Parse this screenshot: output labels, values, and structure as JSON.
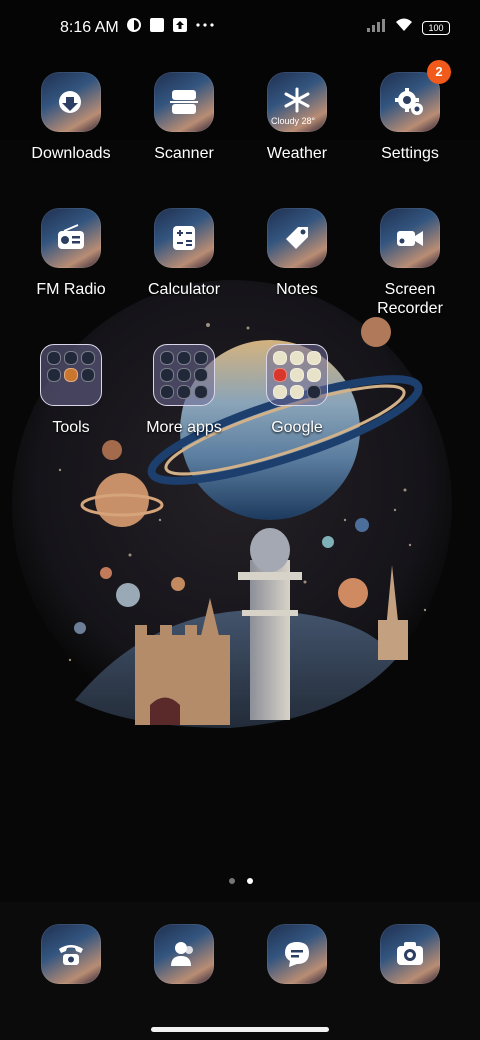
{
  "status_bar": {
    "time": "8:16 AM",
    "notification_icons": [
      "app-notification-icon",
      "white-square-icon",
      "upload-arrow-icon",
      "more-dots-icon"
    ],
    "battery_level": "100"
  },
  "home": {
    "apps": [
      {
        "label": "Downloads",
        "icon": "download-icon"
      },
      {
        "label": "Scanner",
        "icon": "scanner-icon"
      },
      {
        "label": "Weather",
        "icon": "snowflake-icon",
        "widget_text": "Cloudy 28°"
      },
      {
        "label": "Settings",
        "icon": "gear-icon",
        "badge": "2"
      },
      {
        "label": "FM Radio",
        "icon": "radio-icon"
      },
      {
        "label": "Calculator",
        "icon": "calculator-icon"
      },
      {
        "label": "Notes",
        "icon": "tag-icon"
      },
      {
        "label": "Screen Recorder",
        "icon": "video-camera-icon"
      }
    ],
    "folders": [
      {
        "label": "Tools"
      },
      {
        "label": "More apps"
      },
      {
        "label": "Google"
      }
    ],
    "page_indicator": {
      "pages": 2,
      "current": 2
    }
  },
  "dock": {
    "apps": [
      {
        "name": "Phone",
        "icon": "phone-icon"
      },
      {
        "name": "Contacts",
        "icon": "contacts-icon"
      },
      {
        "name": "Messages",
        "icon": "message-icon"
      },
      {
        "name": "Camera",
        "icon": "camera-icon"
      }
    ]
  },
  "colors": {
    "background": "#070707",
    "badge": "#f15a1a",
    "folder_border": "#d9d6ea"
  }
}
